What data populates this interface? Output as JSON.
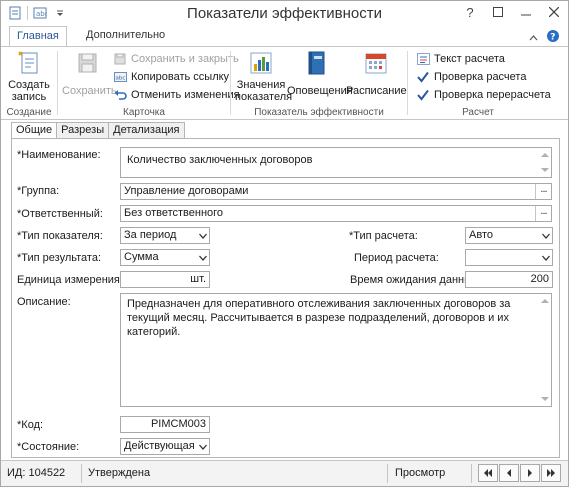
{
  "window": {
    "title": "Показатели эффективности"
  },
  "ribbon": {
    "tabs": [
      "Главная",
      "Дополнительно"
    ],
    "groups": {
      "create": {
        "label": "Создание",
        "create_button": "Создать запись"
      },
      "card": {
        "label": "Карточка",
        "save_button": "Сохранить",
        "save_close_button": "Сохранить и закрыть",
        "copy_link_button": "Копировать ссылку",
        "undo_button": "Отменить изменения"
      },
      "indicator": {
        "label": "Показатель эффективности",
        "values_button": "Значения показателя",
        "alerts_button": "Оповещения",
        "schedule_button": "Расписание"
      },
      "calc": {
        "label": "Расчет",
        "calc_text_button": "Текст расчета",
        "check_calc_button": "Проверка расчета",
        "check_recalc_button": "Проверка перерасчета"
      }
    }
  },
  "form": {
    "tabs": [
      "Общие",
      "Разрезы",
      "Детализация"
    ],
    "name": {
      "label": "*Наименование:",
      "value": "Количество заключенных договоров"
    },
    "group": {
      "label": "*Группа:",
      "value": "Управление договорами"
    },
    "responsible": {
      "label": "*Ответственный:",
      "value": "Без ответственного"
    },
    "indicator_type": {
      "label": "*Тип показателя:",
      "value": "За период"
    },
    "calc_type": {
      "label": "*Тип расчета:",
      "value": "Авто"
    },
    "result_type": {
      "label": "*Тип результата:",
      "value": "Сумма"
    },
    "calc_period": {
      "label": "Период расчета:",
      "value": ""
    },
    "unit": {
      "label": "Единица измерения:",
      "value": "шт."
    },
    "wait_time": {
      "label": "Время ожидания данных:",
      "value": "200"
    },
    "description": {
      "label": "Описание:",
      "value": "Предназначен для оперативного отслеживания заключенных договоров за текущий месяц. Рассчитывается в разрезе подразделений, договоров и их категорий."
    },
    "code": {
      "label": "*Код:",
      "value": "PIMCM003"
    },
    "state": {
      "label": "*Состояние:",
      "value": "Действующая"
    }
  },
  "status": {
    "id": "ИД: 104522",
    "state": "Утверждена",
    "mode": "Просмотр"
  },
  "colors": {
    "accent": "#2b579a",
    "check": "#2b579a"
  }
}
